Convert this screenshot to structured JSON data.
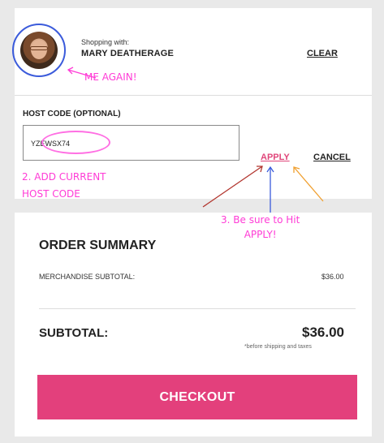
{
  "shopper": {
    "shopping_with_label": "Shopping with:",
    "name": "MARY DEATHERAGE",
    "clear_label": "CLEAR"
  },
  "host_code": {
    "label": "HOST CODE (OPTIONAL)",
    "value": "YZEWSX74",
    "apply_label": "APPLY",
    "cancel_label": "CANCEL"
  },
  "annotations": {
    "me_again": "ME AGAIN!",
    "add_current_line1": "2. ADD CURRENT",
    "add_current_line2": "HOST CODE",
    "be_sure_line1": "3. Be sure to Hit",
    "be_sure_line2": "APPLY!"
  },
  "order_summary": {
    "title": "ORDER SUMMARY",
    "merchandise_label": "MERCHANDISE SUBTOTAL:",
    "merchandise_value": "$36.00",
    "subtotal_label": "SUBTOTAL:",
    "subtotal_value": "$36.00",
    "subtotal_note": "*before shipping and taxes",
    "checkout_label": "CHECKOUT"
  },
  "colors": {
    "annotation_pink": "#ff3bd6",
    "checkout_pink": "#e3407c",
    "avatar_ring_blue": "#3b5bdb"
  }
}
